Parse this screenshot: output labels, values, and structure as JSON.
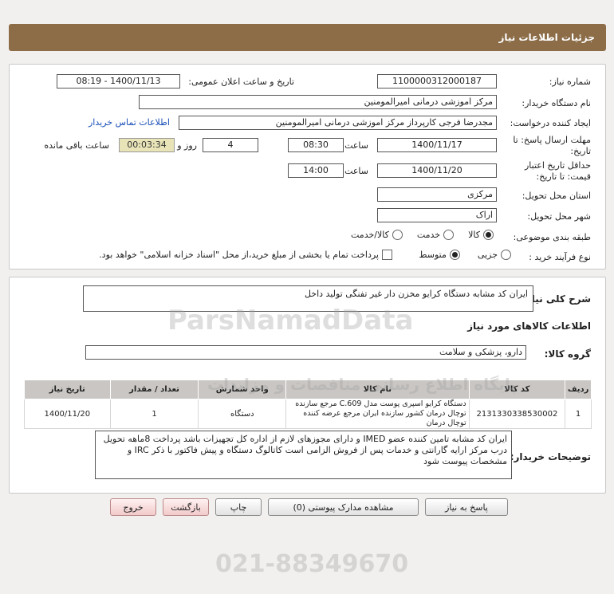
{
  "header": {
    "title": "جزئیات اطلاعات نیاز"
  },
  "form": {
    "need_number_label": "شماره نیاز:",
    "need_number": "1100000312000187",
    "announce_label": "تاریخ و ساعت اعلان عمومی:",
    "announce_value": "1400/11/13 - 08:19",
    "buyer_org_label": "نام دستگاه خریدار:",
    "buyer_org": "مرکز اموزشی درمانی امیرالمومنین",
    "creator_label": "ایجاد کننده درخواست:",
    "creator": "مجدرضا فرجی کارپرداز مرکز اموزشی درمانی امیرالمومنین",
    "contact_link": "اطلاعات تماس خریدار",
    "reply_deadline_label": "مهلت ارسال پاسخ: تا تاریخ:",
    "reply_date": "1400/11/17",
    "time_label": "ساعت",
    "reply_time": "08:30",
    "days": "4",
    "days_label": "روز و",
    "remaining": "00:03:34",
    "remaining_label": "ساعت باقی مانده",
    "validity_label": "حداقل تاریخ اعتبار قیمت: تا تاریخ:",
    "validity_date": "1400/11/20",
    "validity_time": "14:00",
    "province_label": "استان محل تحویل:",
    "province": "مرکزی",
    "city_label": "شهر محل تحویل:",
    "city": "اراک",
    "category_label": "طبقه بندی موضوعی:",
    "category_options": [
      "کالا",
      "خدمت",
      "کالا/خدمت"
    ],
    "process_label": "نوع فرآیند خرید :",
    "process_options": [
      "جزیی",
      "متوسط"
    ],
    "payment_note": "پرداخت تمام یا بخشی از مبلغ خرید،از محل \"اسناد خزانه اسلامی\" خواهد بود."
  },
  "details": {
    "summary_label": "شرح کلی نیاز:",
    "summary": "ایران کد مشابه دستگاه کرایو مخزن دار غیر تفنگی تولید داخل",
    "goods_info_title": "اطلاعات کالاهای مورد نیاز",
    "goods_group_label": "گروه کالا:",
    "goods_group": "دارو، پزشکی و سلامت",
    "table": {
      "headers": [
        "ردیف",
        "کد کالا",
        "نام کالا",
        "واحد شمارش",
        "تعداد / مقدار",
        "تاریخ نیاز"
      ],
      "rows": [
        [
          "1",
          "2131330338530002",
          "دستگاه کرایو اسپری پوست مدل C.609 مرجع سازنده توچال درمان کشور سازنده ایران مرجع عرضه کننده توچال درمان",
          "دستگاه",
          "1",
          "1400/11/20"
        ]
      ]
    },
    "buyer_notes_label": "توضیحات خریدار:",
    "buyer_notes": "ایران کد مشابه تامین کننده عضو IMED و دارای مجوزهای لازم از اداره کل تجهیزات باشد پرداخت 8ماهه تحویل درب مرکز ارایه گارانتی و خدمات پس از فروش الزامی است کاتالوگ دستگاه و پیش فاکتور با ذکر IRC و مشخصات پیوست شود"
  },
  "buttons": {
    "reply": "پاسخ به نیاز",
    "attachments": "مشاهده مدارک پیوستی (0)",
    "print": "چاپ",
    "back": "بازگشت",
    "exit": "خروج"
  },
  "watermark": {
    "brand": "ParsNamadData",
    "tagline": "پایگاه اطلاع رسانی مناقصات و مزایدات",
    "phone": "021-88349670"
  },
  "colors": {
    "header_bg": "#8c6d48",
    "remaining_bg": "#e9e4b8",
    "table_header_bg": "#c9c6c3",
    "link": "#1a4fb8"
  }
}
